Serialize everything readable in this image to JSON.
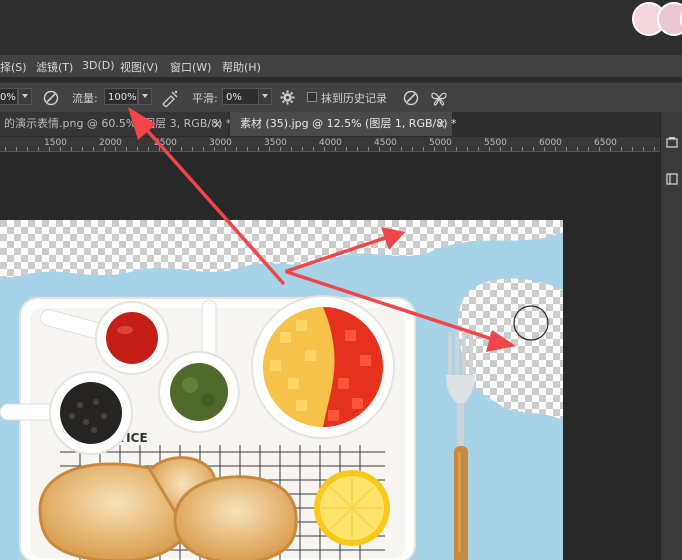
{
  "menu": {
    "items": [
      {
        "label": "择(S)"
      },
      {
        "label": "滤镜(T)"
      },
      {
        "label": "3D(D)"
      },
      {
        "label": "视图(V)"
      },
      {
        "label": "窗口(W)"
      },
      {
        "label": "帮助(H)"
      }
    ]
  },
  "options": {
    "opacity_value": "0%",
    "flow_label": "流量:",
    "flow_value": "100%",
    "smoothing_label": "平滑:",
    "smoothing_value": "0%",
    "erase_history_label": "抹到历史记录"
  },
  "tabs": [
    {
      "label": "的演示表情.png @ 60.5% (图层 3, RGB/8) *",
      "close": "×"
    },
    {
      "label": "素材 (35).jpg @ 12.5% (图层 1, RGB/8) *",
      "close": "×"
    }
  ],
  "ruler": {
    "labels": [
      "1500",
      "2000",
      "2500",
      "3000",
      "3500",
      "4000",
      "4500",
      "5000",
      "5500",
      "6000",
      "6500"
    ]
  },
  "canvas": {
    "tray_text": "TICE"
  },
  "colors": {
    "accent_arrow": "#f0464a",
    "canvas_blue": "#a7d3e8",
    "panel_bg": "#424242"
  }
}
